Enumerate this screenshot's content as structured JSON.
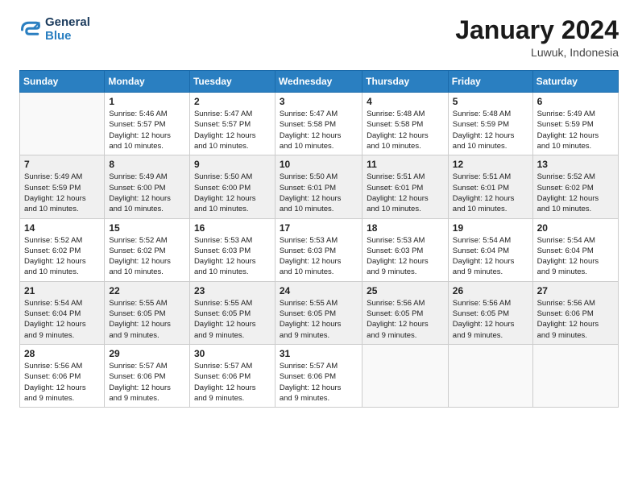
{
  "header": {
    "logo_line1": "General",
    "logo_line2": "Blue",
    "month": "January 2024",
    "location": "Luwuk, Indonesia"
  },
  "weekdays": [
    "Sunday",
    "Monday",
    "Tuesday",
    "Wednesday",
    "Thursday",
    "Friday",
    "Saturday"
  ],
  "weeks": [
    [
      {
        "day": "",
        "info": ""
      },
      {
        "day": "1",
        "info": "Sunrise: 5:46 AM\nSunset: 5:57 PM\nDaylight: 12 hours\nand 10 minutes."
      },
      {
        "day": "2",
        "info": "Sunrise: 5:47 AM\nSunset: 5:57 PM\nDaylight: 12 hours\nand 10 minutes."
      },
      {
        "day": "3",
        "info": "Sunrise: 5:47 AM\nSunset: 5:58 PM\nDaylight: 12 hours\nand 10 minutes."
      },
      {
        "day": "4",
        "info": "Sunrise: 5:48 AM\nSunset: 5:58 PM\nDaylight: 12 hours\nand 10 minutes."
      },
      {
        "day": "5",
        "info": "Sunrise: 5:48 AM\nSunset: 5:59 PM\nDaylight: 12 hours\nand 10 minutes."
      },
      {
        "day": "6",
        "info": "Sunrise: 5:49 AM\nSunset: 5:59 PM\nDaylight: 12 hours\nand 10 minutes."
      }
    ],
    [
      {
        "day": "7",
        "info": "Sunrise: 5:49 AM\nSunset: 5:59 PM\nDaylight: 12 hours\nand 10 minutes."
      },
      {
        "day": "8",
        "info": "Sunrise: 5:49 AM\nSunset: 6:00 PM\nDaylight: 12 hours\nand 10 minutes."
      },
      {
        "day": "9",
        "info": "Sunrise: 5:50 AM\nSunset: 6:00 PM\nDaylight: 12 hours\nand 10 minutes."
      },
      {
        "day": "10",
        "info": "Sunrise: 5:50 AM\nSunset: 6:01 PM\nDaylight: 12 hours\nand 10 minutes."
      },
      {
        "day": "11",
        "info": "Sunrise: 5:51 AM\nSunset: 6:01 PM\nDaylight: 12 hours\nand 10 minutes."
      },
      {
        "day": "12",
        "info": "Sunrise: 5:51 AM\nSunset: 6:01 PM\nDaylight: 12 hours\nand 10 minutes."
      },
      {
        "day": "13",
        "info": "Sunrise: 5:52 AM\nSunset: 6:02 PM\nDaylight: 12 hours\nand 10 minutes."
      }
    ],
    [
      {
        "day": "14",
        "info": "Sunrise: 5:52 AM\nSunset: 6:02 PM\nDaylight: 12 hours\nand 10 minutes."
      },
      {
        "day": "15",
        "info": "Sunrise: 5:52 AM\nSunset: 6:02 PM\nDaylight: 12 hours\nand 10 minutes."
      },
      {
        "day": "16",
        "info": "Sunrise: 5:53 AM\nSunset: 6:03 PM\nDaylight: 12 hours\nand 10 minutes."
      },
      {
        "day": "17",
        "info": "Sunrise: 5:53 AM\nSunset: 6:03 PM\nDaylight: 12 hours\nand 10 minutes."
      },
      {
        "day": "18",
        "info": "Sunrise: 5:53 AM\nSunset: 6:03 PM\nDaylight: 12 hours\nand 9 minutes."
      },
      {
        "day": "19",
        "info": "Sunrise: 5:54 AM\nSunset: 6:04 PM\nDaylight: 12 hours\nand 9 minutes."
      },
      {
        "day": "20",
        "info": "Sunrise: 5:54 AM\nSunset: 6:04 PM\nDaylight: 12 hours\nand 9 minutes."
      }
    ],
    [
      {
        "day": "21",
        "info": "Sunrise: 5:54 AM\nSunset: 6:04 PM\nDaylight: 12 hours\nand 9 minutes."
      },
      {
        "day": "22",
        "info": "Sunrise: 5:55 AM\nSunset: 6:05 PM\nDaylight: 12 hours\nand 9 minutes."
      },
      {
        "day": "23",
        "info": "Sunrise: 5:55 AM\nSunset: 6:05 PM\nDaylight: 12 hours\nand 9 minutes."
      },
      {
        "day": "24",
        "info": "Sunrise: 5:55 AM\nSunset: 6:05 PM\nDaylight: 12 hours\nand 9 minutes."
      },
      {
        "day": "25",
        "info": "Sunrise: 5:56 AM\nSunset: 6:05 PM\nDaylight: 12 hours\nand 9 minutes."
      },
      {
        "day": "26",
        "info": "Sunrise: 5:56 AM\nSunset: 6:05 PM\nDaylight: 12 hours\nand 9 minutes."
      },
      {
        "day": "27",
        "info": "Sunrise: 5:56 AM\nSunset: 6:06 PM\nDaylight: 12 hours\nand 9 minutes."
      }
    ],
    [
      {
        "day": "28",
        "info": "Sunrise: 5:56 AM\nSunset: 6:06 PM\nDaylight: 12 hours\nand 9 minutes."
      },
      {
        "day": "29",
        "info": "Sunrise: 5:57 AM\nSunset: 6:06 PM\nDaylight: 12 hours\nand 9 minutes."
      },
      {
        "day": "30",
        "info": "Sunrise: 5:57 AM\nSunset: 6:06 PM\nDaylight: 12 hours\nand 9 minutes."
      },
      {
        "day": "31",
        "info": "Sunrise: 5:57 AM\nSunset: 6:06 PM\nDaylight: 12 hours\nand 9 minutes."
      },
      {
        "day": "",
        "info": ""
      },
      {
        "day": "",
        "info": ""
      },
      {
        "day": "",
        "info": ""
      }
    ]
  ]
}
